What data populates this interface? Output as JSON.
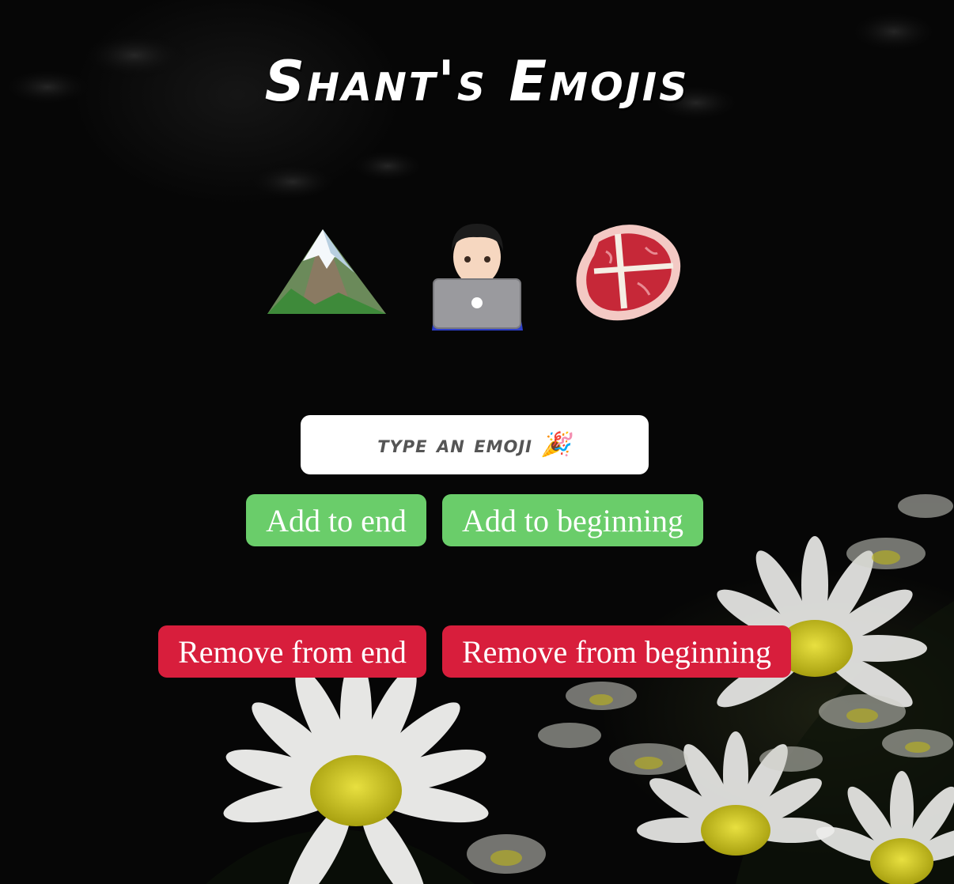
{
  "title": "Shant's Emojis",
  "emojis": [
    {
      "char": "🏔️",
      "icon": "snow-capped-mountain-icon"
    },
    {
      "char": "👨‍💻",
      "icon": "man-technologist-icon"
    },
    {
      "char": "🥩",
      "icon": "cut-of-meat-icon"
    }
  ],
  "input": {
    "placeholder": "type an emoji 🎉",
    "value": ""
  },
  "buttons": {
    "add_end": "Add to end",
    "add_beginning": "Add to beginning",
    "remove_end": "Remove from end",
    "remove_beginning": "Remove from beginning"
  },
  "colors": {
    "add": "#6acd6a",
    "remove": "#d81e3c",
    "title": "#ffffff",
    "background": "#060606"
  }
}
